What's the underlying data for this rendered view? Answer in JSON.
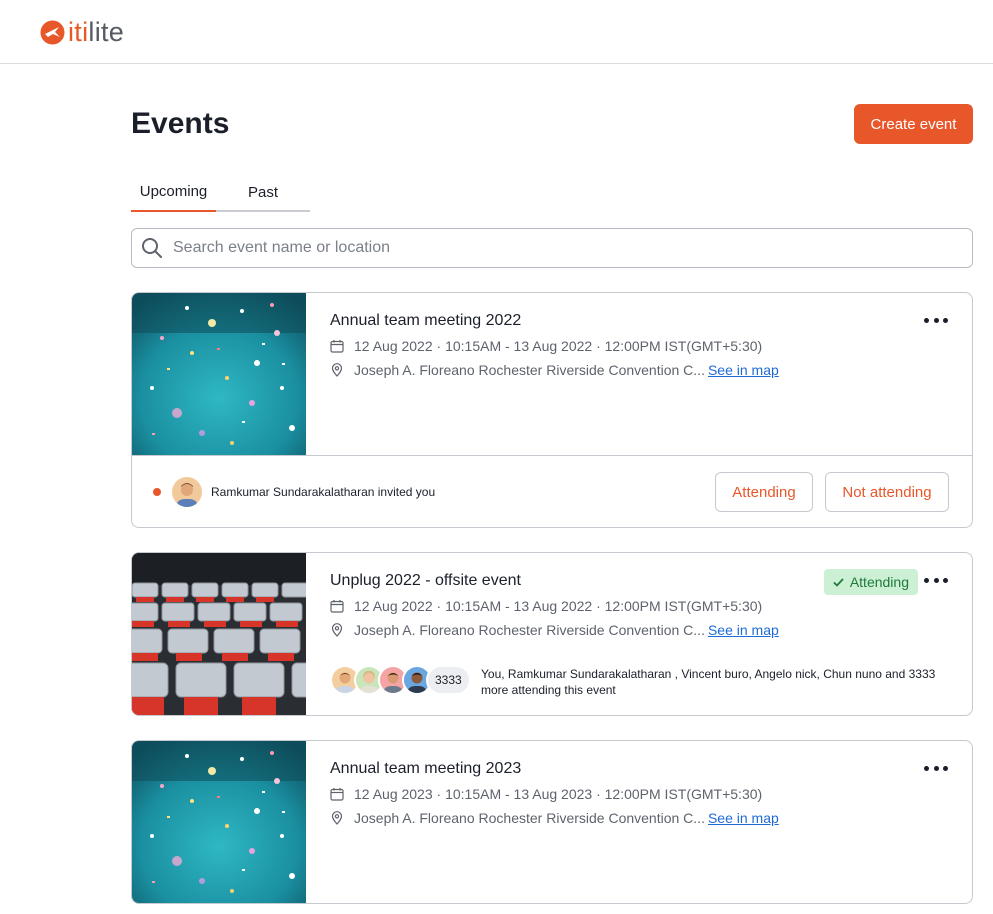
{
  "brand": {
    "logo_prefix": "",
    "logo_accent": "iti",
    "logo_rest": "lite",
    "accent_color": "#e8572a"
  },
  "header": {
    "title": "Events",
    "create_button": "Create event"
  },
  "tabs": [
    {
      "label": "Upcoming",
      "active": true
    },
    {
      "label": "Past",
      "active": false
    }
  ],
  "search": {
    "placeholder": "Search event name or location",
    "value": ""
  },
  "events": [
    {
      "title": "Annual team meeting 2022",
      "datetime": "12 Aug 2022 · 10:15AM - 13 Aug 2022 · 12:00PM IST(GMT+5:30)",
      "location": "Joseph A. Floreano Rochester Riverside Convention C...",
      "map_link": "See in map",
      "image": "confetti",
      "invite": {
        "text": "Ramkumar Sundarakalatharan invited you",
        "attending_label": "Attending",
        "not_attending_label": "Not attending"
      }
    },
    {
      "title": "Unplug 2022 - offsite event",
      "datetime": "12 Aug 2022 · 10:15AM - 13 Aug 2022 · 12:00PM IST(GMT+5:30)",
      "location": "Joseph A. Floreano Rochester Riverside Convention C...",
      "map_link": "See in map",
      "image": "auditorium-seats",
      "status_badge": "Attending",
      "attendees": {
        "extra_count": "3333",
        "text": "You, Ramkumar Sundarakalatharan , Vincent buro, Angelo nick, Chun nuno  and 3333 more attending this event"
      }
    },
    {
      "title": "Annual team meeting 2023",
      "datetime": "12 Aug 2023 · 10:15AM - 13 Aug 2023 · 12:00PM IST(GMT+5:30)",
      "location": "Joseph A. Floreano Rochester Riverside Convention C...",
      "map_link": "See in map",
      "image": "confetti"
    }
  ]
}
